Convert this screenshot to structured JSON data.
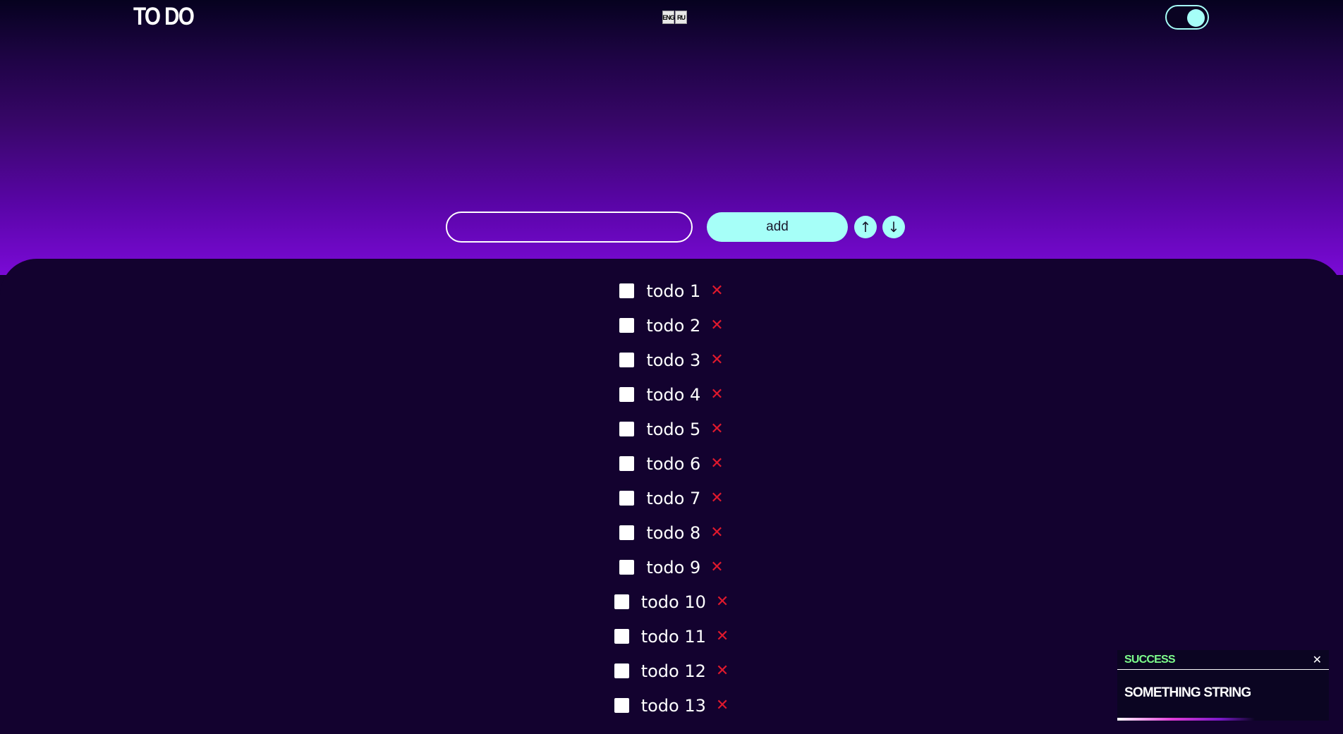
{
  "app": {
    "title": "TO DO"
  },
  "language": {
    "options": [
      "ENG",
      "RU"
    ]
  },
  "theme_toggle": {
    "on": true
  },
  "form": {
    "input_value": "",
    "input_placeholder": "",
    "add_label": "add",
    "sort_up_label": "↑",
    "sort_down_label": "↓"
  },
  "todos": [
    {
      "text": "todo 1",
      "checked": false
    },
    {
      "text": "todo 2",
      "checked": false
    },
    {
      "text": "todo 3",
      "checked": false
    },
    {
      "text": "todo 4",
      "checked": false
    },
    {
      "text": "todo 5",
      "checked": false
    },
    {
      "text": "todo 6",
      "checked": false
    },
    {
      "text": "todo 7",
      "checked": false
    },
    {
      "text": "todo 8",
      "checked": false
    },
    {
      "text": "todo 9",
      "checked": false
    },
    {
      "text": "todo 10",
      "checked": false
    },
    {
      "text": "todo 11",
      "checked": false
    },
    {
      "text": "todo 12",
      "checked": false
    },
    {
      "text": "todo 13",
      "checked": false
    }
  ],
  "delete_glyph": "✕",
  "toast": {
    "type": "SUCCESS",
    "message": "SOMETHING STRING",
    "close_label": "✕",
    "progress": 0.65
  },
  "colors": {
    "accent": "#a6fff8",
    "delete": "#e0192d",
    "success": "#7dff8c",
    "panel": "#13022f"
  }
}
